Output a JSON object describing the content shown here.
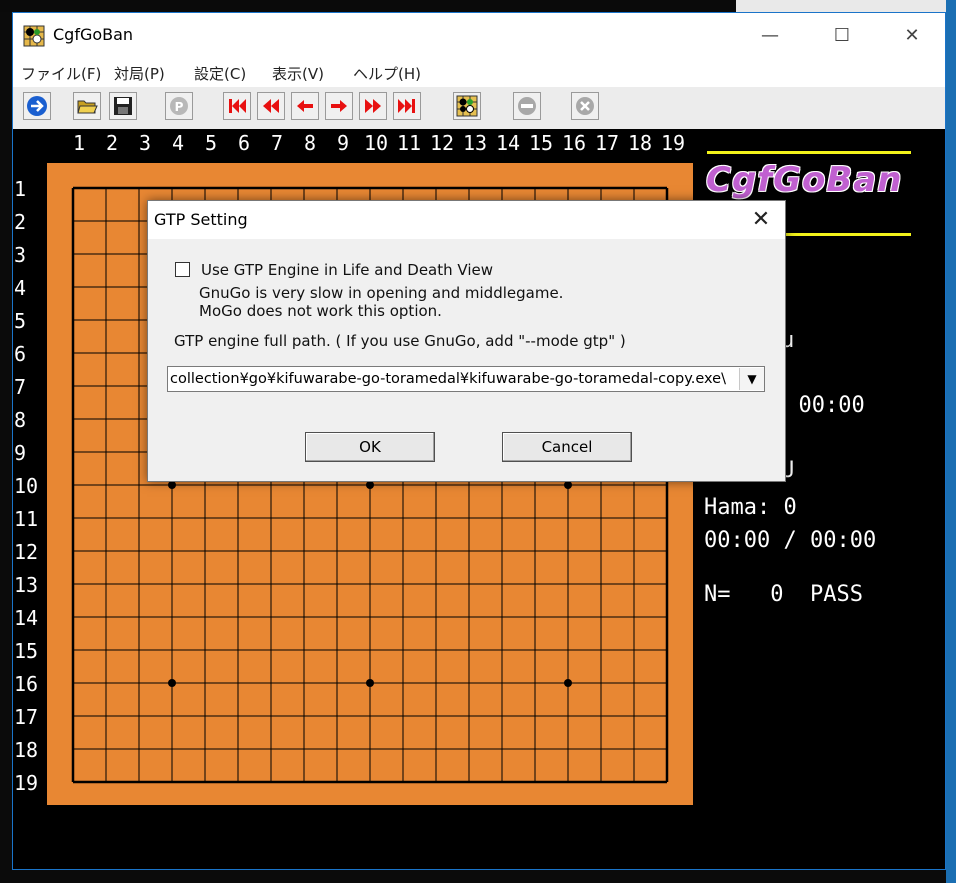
{
  "window": {
    "title": "CgfGoBan",
    "minimize": "—",
    "maximize": "☐",
    "close": "✕"
  },
  "menu": [
    "ファイル(F)",
    "対局(P)",
    "設定(C)",
    "表示(V)",
    "ヘルプ(H)"
  ],
  "board": {
    "columns": [
      "1",
      "2",
      "3",
      "4",
      "5",
      "6",
      "7",
      "8",
      "9",
      "10",
      "11",
      "12",
      "13",
      "14",
      "15",
      "16",
      "17",
      "18",
      "19"
    ],
    "rows": [
      "1",
      "2",
      "3",
      "4",
      "5",
      "6",
      "7",
      "8",
      "9",
      "10",
      "11",
      "12",
      "13",
      "14",
      "15",
      "16",
      "17",
      "18",
      "19"
    ],
    "board_color": "#e88733"
  },
  "panel": {
    "brand": "CgfGoBan",
    "black_name_fragment": "u",
    "black_time_fragment": "/ 00:00",
    "white_name_fragment": "U",
    "hama": "Hama: 0",
    "time": "00:00 / 00:00",
    "move": "N=   0  PASS"
  },
  "dialog": {
    "title": "GTP Setting",
    "close": "✕",
    "checkbox_label": "Use GTP Engine in Life and Death View",
    "note_1": "GnuGo is very slow in opening and middlegame.",
    "note_2": "MoGo does not work this option.",
    "path_label": "GTP engine full path. ( If you use GnuGo, add \"--mode gtp\" )",
    "path_value": "\\collection¥go¥kifuwarabe-go-toramedal¥kifuwarabe-go-toramedal-copy.exe",
    "ok": "OK",
    "cancel": "Cancel"
  }
}
